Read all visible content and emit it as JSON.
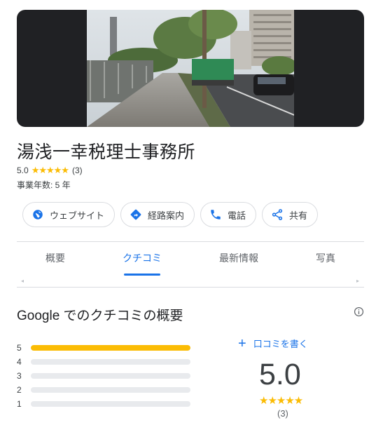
{
  "business": {
    "name": "湯浅一幸税理士事務所",
    "rating": "5.0",
    "stars": "★★★★★",
    "review_count": "(3)",
    "years_in_business": "事業年数: 5 年"
  },
  "actions": [
    {
      "label": "ウェブサイト",
      "icon": "globe-icon"
    },
    {
      "label": "経路案内",
      "icon": "directions-icon"
    },
    {
      "label": "電話",
      "icon": "phone-icon"
    },
    {
      "label": "共有",
      "icon": "share-icon"
    }
  ],
  "tabs": [
    {
      "label": "概要",
      "active": false
    },
    {
      "label": "クチコミ",
      "active": true
    },
    {
      "label": "最新情報",
      "active": false
    },
    {
      "label": "写真",
      "active": false
    }
  ],
  "reviews": {
    "summary_title": "Google でのクチコミの概要",
    "write_review_label": "口コミを書く",
    "distribution": [
      {
        "stars": "5",
        "fraction": 1.0
      },
      {
        "stars": "4",
        "fraction": 0
      },
      {
        "stars": "3",
        "fraction": 0
      },
      {
        "stars": "2",
        "fraction": 0
      },
      {
        "stars": "1",
        "fraction": 0
      }
    ],
    "average": "5.0",
    "stars": "★★★★★",
    "count": "(3)"
  },
  "colors": {
    "accent": "#1a73e8",
    "star": "#fbbc04",
    "track": "#e8eaed"
  }
}
